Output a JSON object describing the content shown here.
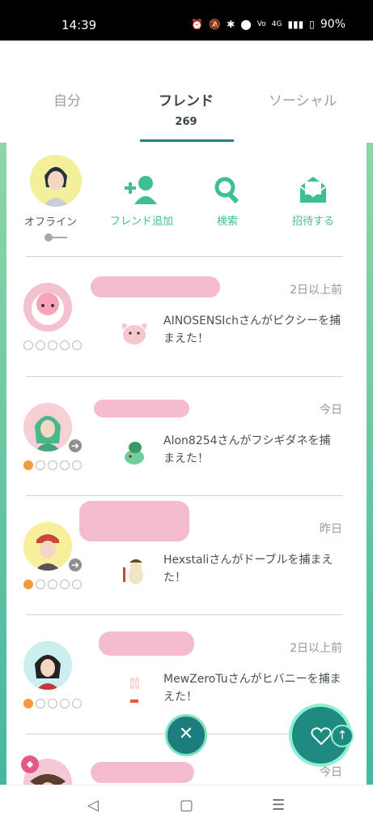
{
  "status_bar": {
    "time": "14:39",
    "icons": [
      "alarm-icon",
      "mute-icon",
      "bluetooth-icon",
      "location-icon",
      "volte-icon",
      "signal-icon",
      "battery-icon"
    ],
    "network": "4G",
    "battery": "90%"
  },
  "tabs": [
    {
      "label": "自分",
      "active": false
    },
    {
      "label": "フレンド",
      "count": "269",
      "active": true
    },
    {
      "label": "ソーシャル",
      "active": false
    }
  ],
  "me": {
    "status_label": "オフライン"
  },
  "actions": [
    {
      "label": "フレンド追加",
      "icon": "add-friend-icon"
    },
    {
      "label": "検索",
      "icon": "search-icon"
    },
    {
      "label": "招待する",
      "icon": "invite-envelope-icon"
    }
  ],
  "friends": [
    {
      "when": "2日以上前",
      "message": "AINOSENSIchさんがピクシーを捕まえた！",
      "hearts": 0,
      "remote": false,
      "avatar_bg": "#f4c1cf"
    },
    {
      "when": "今日",
      "message": "Alon8254さんがフシギダネを捕まえた！",
      "hearts": 1,
      "remote": true,
      "avatar_bg": "#f6d0d5"
    },
    {
      "when": "昨日",
      "message": "Hexstaliさんがドーブルを捕まえた！",
      "hearts": 1,
      "remote": true,
      "avatar_bg": "#f7ef9c"
    },
    {
      "when": "2日以上前",
      "message": "MewZeroTuさんがヒバニーを捕まえた！",
      "hearts": 1,
      "remote": false,
      "avatar_bg": "#cbeef1"
    },
    {
      "when": "今日",
      "message": "",
      "hearts": 0,
      "remote": false,
      "avatar_bg": "#f4c9d5"
    }
  ],
  "colors": {
    "accent": "#3dbf96",
    "tab_underline": "#2f7c8c",
    "heart_on": "#f39a3c",
    "fab": "#1f8a80"
  }
}
